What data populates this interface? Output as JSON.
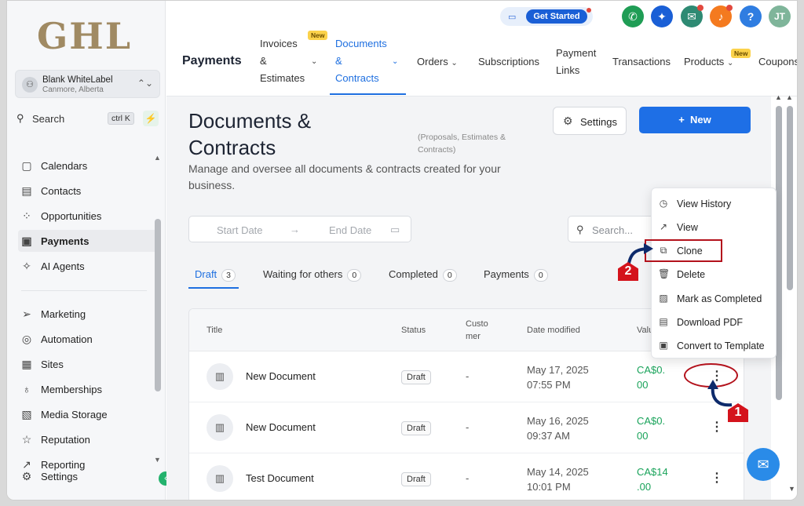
{
  "sidebar": {
    "logo": "GHL",
    "account": {
      "initial": "⚇",
      "name": "Blank WhiteLabel",
      "location": "Canmore, Alberta"
    },
    "search": {
      "label": "Search",
      "shortcut": "ctrl K"
    },
    "nav": [
      {
        "label": "Calendars",
        "icon": "▢"
      },
      {
        "label": "Contacts",
        "icon": "▤"
      },
      {
        "label": "Opportunities",
        "icon": "⁘"
      },
      {
        "label": "Payments",
        "icon": "▣"
      },
      {
        "label": "AI Agents",
        "icon": "✧"
      },
      {
        "label": "Marketing",
        "icon": "➢"
      },
      {
        "label": "Automation",
        "icon": "◎"
      },
      {
        "label": "Sites",
        "icon": "▦"
      },
      {
        "label": "Memberships",
        "icon": "♁"
      },
      {
        "label": "Media Storage",
        "icon": "▧"
      },
      {
        "label": "Reputation",
        "icon": "☆"
      },
      {
        "label": "Reporting",
        "icon": "↗"
      },
      {
        "label": "Settings",
        "icon": "⚙"
      }
    ]
  },
  "topbar": {
    "get_started": "Get Started",
    "avatar_initials": "JT",
    "brand": "Payments",
    "badge_new": "New",
    "nav": {
      "invoices_l1": "Invoices",
      "invoices_l2": "&",
      "invoices_l3": "Estimates",
      "documents_l1": "Documents",
      "documents_l2": "&",
      "documents_l3": "Contracts",
      "orders": "Orders",
      "subscriptions": "Subscriptions",
      "payment_links_l1": "Payment",
      "payment_links_l2": "Links",
      "transactions": "Transactions",
      "products": "Products",
      "coupons": "Coupons"
    },
    "colors": {
      "green": "#1f9d55",
      "blue": "#1a5fd6",
      "teal": "#2e8a73",
      "orange": "#f47a1f",
      "help": "#2f7de1",
      "avatar": "#7fb59a"
    }
  },
  "main": {
    "title": "Documents & Contracts",
    "subtitle_note": "(Proposals, Estimates & Contracts)",
    "description": "Manage and oversee all documents & contracts created for your business.",
    "settings_label": "Settings",
    "new_label": "New",
    "date": {
      "start_placeholder": "Start Date",
      "end_placeholder": "End Date"
    },
    "search_placeholder": "Search...",
    "tabs": [
      {
        "label": "Draft",
        "count": "3"
      },
      {
        "label": "Waiting for others",
        "count": "0"
      },
      {
        "label": "Completed",
        "count": "0"
      },
      {
        "label": "Payments",
        "count": "0"
      }
    ],
    "table": {
      "headers": {
        "title": "Title",
        "status": "Status",
        "customer_l1": "Custo",
        "customer_l2": "mer",
        "date_modified": "Date modified",
        "value": "Valu"
      },
      "rows": [
        {
          "title": "New Document",
          "status": "Draft",
          "customer": "-",
          "date": "May 17, 2025",
          "time": "07:55 PM",
          "value_l1": "CA$0.",
          "value_l2": "00"
        },
        {
          "title": "New Document",
          "status": "Draft",
          "customer": "-",
          "date": "May 16, 2025",
          "time": "09:37 AM",
          "value_l1": "CA$0.",
          "value_l2": "00"
        },
        {
          "title": "Test Document",
          "status": "Draft",
          "customer": "-",
          "date": "May 14, 2025",
          "time": "10:01 PM",
          "value_l1": "CA$14",
          "value_l2": ".00"
        }
      ]
    }
  },
  "context_menu": [
    {
      "label": "View History",
      "icon": "◷"
    },
    {
      "label": "View",
      "icon": "↗"
    },
    {
      "label": "Clone",
      "icon": "⧉"
    },
    {
      "label": "Delete",
      "icon": "🗑"
    },
    {
      "label": "Mark as Completed",
      "icon": "▨"
    },
    {
      "label": "Download PDF",
      "icon": "▤"
    },
    {
      "label": "Convert to Template",
      "icon": "▣"
    }
  ],
  "annotations": {
    "step1": "1",
    "step2": "2"
  }
}
